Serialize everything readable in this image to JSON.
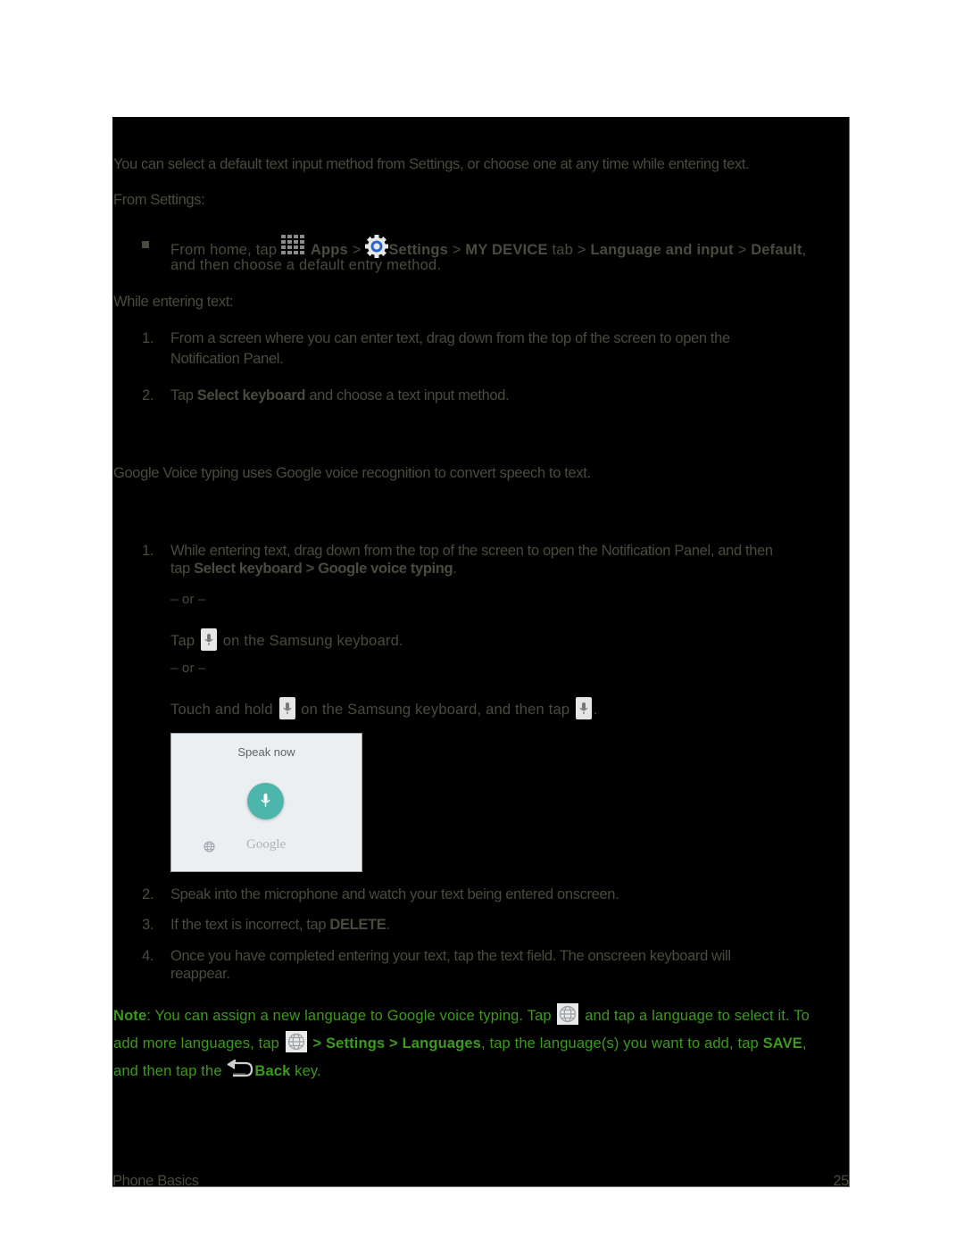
{
  "intro": "You can select a default text input method from Settings, or choose one at any time while entering text.",
  "from_settings": {
    "heading": "From Settings:",
    "bullet": {
      "pre": "From home, tap ",
      "apps": "Apps",
      "sep1": " > ",
      "settings": "Settings",
      "sep2": " > ",
      "my_device": "MY DEVICE",
      "tab": " tab > ",
      "lang": "Language and input",
      "sep3": " > ",
      "default": "Default",
      "end": ",",
      "line2": "and then choose a default entry method.",
      "apps_icon": "apps-grid-icon",
      "settings_icon": "settings-gear-icon"
    }
  },
  "while_entering": {
    "heading": "While entering text:",
    "steps": [
      {
        "num": "1.",
        "line1": "From a screen where you can enter text, drag down from the top of the screen to open the",
        "line2": "Notification Panel."
      },
      {
        "num": "2.",
        "pre": "Tap ",
        "bold": "Select keyboard",
        "post": " and choose a text input method."
      }
    ]
  },
  "voice": {
    "intro": "Google Voice typing uses Google voice recognition to convert speech to text.",
    "step1": {
      "num": "1.",
      "line1": "While entering text, drag down from the top of the screen to open the Notification Panel, and then",
      "pre": "tap ",
      "b1": "Select keyboard",
      "sep": " > ",
      "b2": "Google voice typing",
      "end": "."
    },
    "or1": "– or –",
    "tap_mic": {
      "pre": "Tap ",
      "post": " on the Samsung keyboard."
    },
    "or2": "– or –",
    "hold_mic": {
      "pre": "Touch and hold ",
      "mid": " on the Samsung keyboard, and then tap ",
      "end": "."
    },
    "speak_card": {
      "title": "Speak now",
      "brand": "Google",
      "accent": "#4db6ac"
    },
    "steps": [
      {
        "num": "2.",
        "text": "Speak into the microphone and watch your text being entered onscreen."
      },
      {
        "num": "3.",
        "pre": "If the text is incorrect, tap ",
        "bold": "DELETE",
        "post": "."
      },
      {
        "num": "4.",
        "line1": "Once you have completed entering your text, tap the text field. The onscreen keyboard will",
        "line2": "reappear."
      }
    ]
  },
  "note": {
    "label": "Note",
    "l1_pre": ": You can assign a new language to Google voice typing. Tap ",
    "l1_post": " and tap a language to select it. To",
    "l2_pre": "add more languages, tap ",
    "l2_sep": " > ",
    "settings": "Settings",
    "sep": " > ",
    "languages": "Languages",
    "l2_post": ", tap the language(s) you want to add, tap ",
    "save": "SAVE",
    "l2_end": ",",
    "l3_pre": "and then tap the ",
    "back": "Back",
    "l3_post": " key.",
    "color": "#3c9a1c"
  },
  "footer": {
    "section": "Phone Basics",
    "page": "25"
  }
}
